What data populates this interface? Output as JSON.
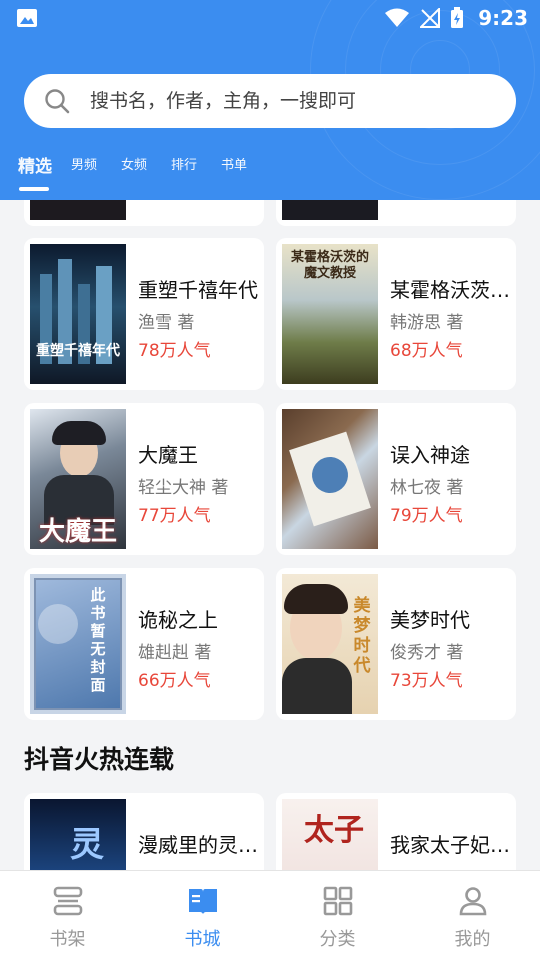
{
  "status_bar": {
    "time": "9:23"
  },
  "search": {
    "placeholder": "搜书名，作者，主角，一搜即可"
  },
  "tabs": [
    {
      "label": "精选",
      "active": true
    },
    {
      "label": "男频"
    },
    {
      "label": "女频"
    },
    {
      "label": "排行"
    },
    {
      "label": "书单"
    }
  ],
  "books": [
    {
      "title": "重塑千禧年代",
      "author": "渔雪 著",
      "popularity": "78万人气",
      "cover_text": "重塑千禧年代"
    },
    {
      "title": "某霍格沃茨的魔文教授",
      "author": "韩游思 著",
      "popularity": "68万人气",
      "cover_text": "某霍格沃茨的魔文教授"
    },
    {
      "title": "大魔王",
      "author": "轻尘大神 著",
      "popularity": "77万人气",
      "cover_text": "大魔王"
    },
    {
      "title": "误入神途",
      "author": "林七夜 著",
      "popularity": "79万人气",
      "cover_text": ""
    },
    {
      "title": "诡秘之上",
      "author": "雄赳赳 著",
      "popularity": "66万人气",
      "cover_text": "此书暂无封面"
    },
    {
      "title": "美梦时代",
      "author": "俊秀才 著",
      "popularity": "73万人气",
      "cover_text": "美梦时代"
    }
  ],
  "section": {
    "title": "抖音火热连载"
  },
  "section_books": [
    {
      "title": "漫威里的灵魂使者",
      "cover_text": "灵"
    },
    {
      "title": "我家太子妃超凶的",
      "cover_text": "太子"
    }
  ],
  "bottom_nav": [
    {
      "label": "书架",
      "icon": "bookshelf-icon"
    },
    {
      "label": "书城",
      "icon": "book-open-icon",
      "active": true
    },
    {
      "label": "分类",
      "icon": "grid-icon"
    },
    {
      "label": "我的",
      "icon": "user-icon"
    }
  ],
  "colors": {
    "primary": "#3b8df0",
    "popularity": "#e8473a",
    "background": "#f3f4f6"
  }
}
